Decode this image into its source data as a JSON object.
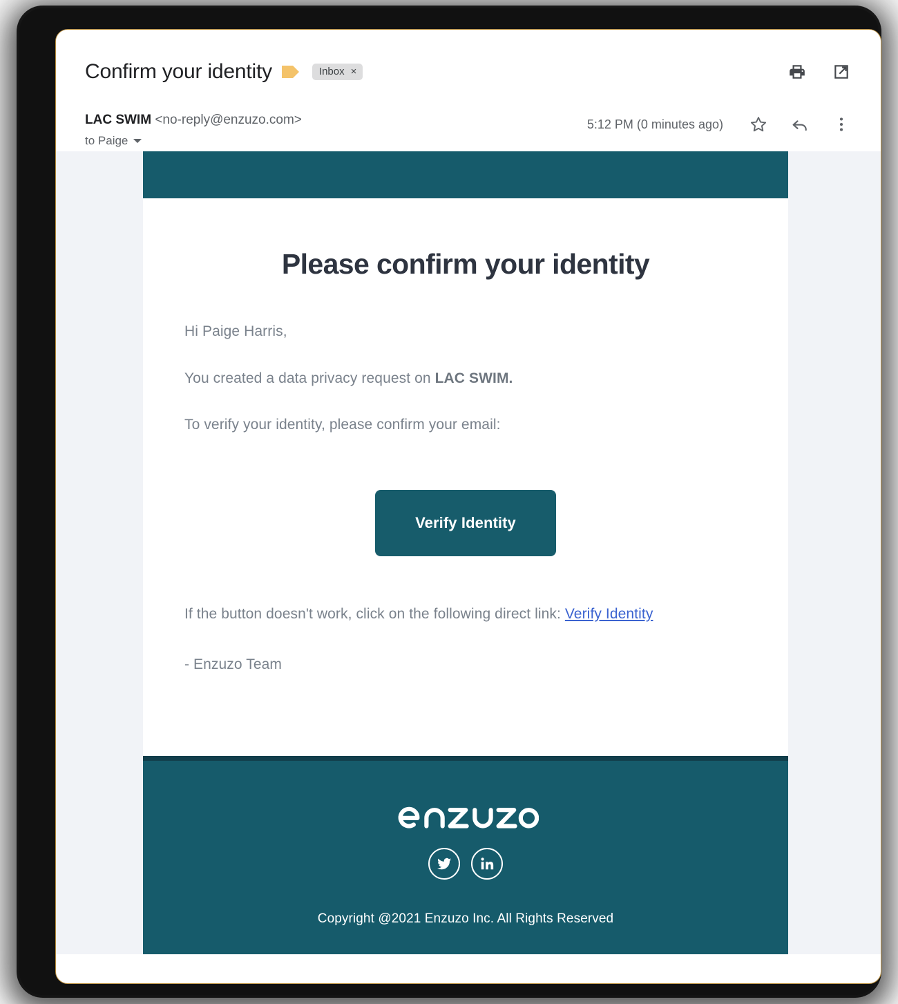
{
  "window": {
    "subject": "Confirm your identity",
    "label_chip": "Inbox",
    "label_chip_close": "×",
    "icons": {
      "important_marker": "important-marker-icon",
      "print": "print-icon",
      "open_in_new": "open-in-new-window-icon",
      "star": "star-icon",
      "reply": "reply-icon",
      "more": "more-options-icon"
    }
  },
  "sender": {
    "name": "LAC SWIM",
    "email": "<no-reply@enzuzo.com>",
    "to": "to Paige",
    "timestamp": "5:12 PM (0 minutes ago)"
  },
  "email": {
    "heading": "Please confirm your identity",
    "greeting": "Hi Paige Harris,",
    "line2_prefix": "You created a data privacy request on ",
    "line2_brand": "LAC SWIM.",
    "line3": "To verify your identity, please confirm your email:",
    "cta_label": "Verify Identity",
    "fallback_prefix": "If the button doesn't work, click on the following direct link: ",
    "fallback_link": "Verify Identity",
    "sign_off": "- Enzuzo Team"
  },
  "footer": {
    "logo_text": "enzuzo",
    "social_twitter": "twitter-icon",
    "social_linkedin": "linkedin-icon",
    "copyright": "Copyright @2021 Enzuzo Inc. All Rights Reserved"
  },
  "colors": {
    "brand_teal": "#165b6b",
    "brand_teal_dark": "#123e4b",
    "button_teal": "#175c6b",
    "link_blue": "#3b63d0",
    "canvas_gray": "#f1f3f7",
    "marker_amber": "#f4c36a",
    "frame_gold": "#b98e3d"
  }
}
